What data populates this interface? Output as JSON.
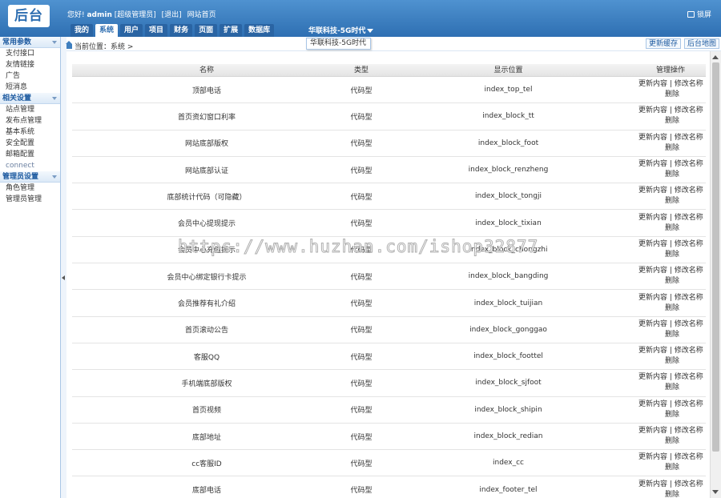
{
  "header": {
    "logo": "后台",
    "greeting": "您好!",
    "username": "admin",
    "role": "[超级管理员]",
    "logout": "[退出]",
    "site_home": "网站首页",
    "lock": "锁屏",
    "site_switch": "华联科技-5G时代"
  },
  "nav": {
    "tabs": [
      {
        "label": "我的"
      },
      {
        "label": "系统"
      },
      {
        "label": "用户"
      },
      {
        "label": "项目"
      },
      {
        "label": "财务"
      },
      {
        "label": "页面"
      },
      {
        "label": "扩展"
      },
      {
        "label": "数据库"
      }
    ],
    "active": "系统"
  },
  "dropdown": {
    "option": "华联科技-5G时代"
  },
  "sidebar": {
    "groups": [
      {
        "title": "常用参数",
        "items": [
          "支付接口",
          "友情链接",
          "广告",
          "短消息"
        ]
      },
      {
        "title": "相关设置",
        "items": [
          "站点管理",
          "发布点管理",
          "基本系统",
          "安全配置",
          "邮箱配置",
          "connect"
        ]
      },
      {
        "title": "管理员设置",
        "items": [
          "角色管理",
          "管理员管理"
        ]
      }
    ]
  },
  "breadcrumb": {
    "text": "当前位置：系统 >"
  },
  "quick": {
    "update_cache": "更新缓存",
    "sitemap": "后台地图"
  },
  "table": {
    "columns": [
      "名称",
      "类型",
      "显示位置",
      "管理操作"
    ],
    "op_update": "更新内容",
    "op_sep": " | ",
    "op_rename": "修改名称",
    "op_sep2": " |",
    "op_delete": "删除",
    "rows": [
      {
        "name": "顶部电话",
        "type": "代码型",
        "pos": "index_top_tel"
      },
      {
        "name": "首页资幻窗口利率",
        "type": "代码型",
        "pos": "index_block_tt"
      },
      {
        "name": "网站底部版权",
        "type": "代码型",
        "pos": "index_block_foot"
      },
      {
        "name": "网站底部认证",
        "type": "代码型",
        "pos": "index_block_renzheng"
      },
      {
        "name": "底部统计代码（可隐藏）",
        "type": "代码型",
        "pos": "index_block_tongji"
      },
      {
        "name": "会员中心提现提示",
        "type": "代码型",
        "pos": "index_block_tixian"
      },
      {
        "name": "会员中心充值提示",
        "type": "代码型",
        "pos": "index_block_chongzhi"
      },
      {
        "name": "会员中心绑定银行卡提示",
        "type": "代码型",
        "pos": "index_block_bangding"
      },
      {
        "name": "会员推荐有礼介绍",
        "type": "代码型",
        "pos": "index_block_tuijian"
      },
      {
        "name": "首页滚动公告",
        "type": "代码型",
        "pos": "index_block_gonggao"
      },
      {
        "name": "客服QQ",
        "type": "代码型",
        "pos": "index_block_foottel"
      },
      {
        "name": "手机端底部版权",
        "type": "代码型",
        "pos": "index_block_sjfoot"
      },
      {
        "name": "首页视频",
        "type": "代码型",
        "pos": "index_block_shipin"
      },
      {
        "name": "底部地址",
        "type": "代码型",
        "pos": "index_block_redian"
      },
      {
        "name": "cc客服ID",
        "type": "代码型",
        "pos": "index_cc"
      },
      {
        "name": "底部电话",
        "type": "代码型",
        "pos": "index_footer_tel"
      }
    ]
  },
  "watermark": "https://www.huzhan.com/ishop32877"
}
